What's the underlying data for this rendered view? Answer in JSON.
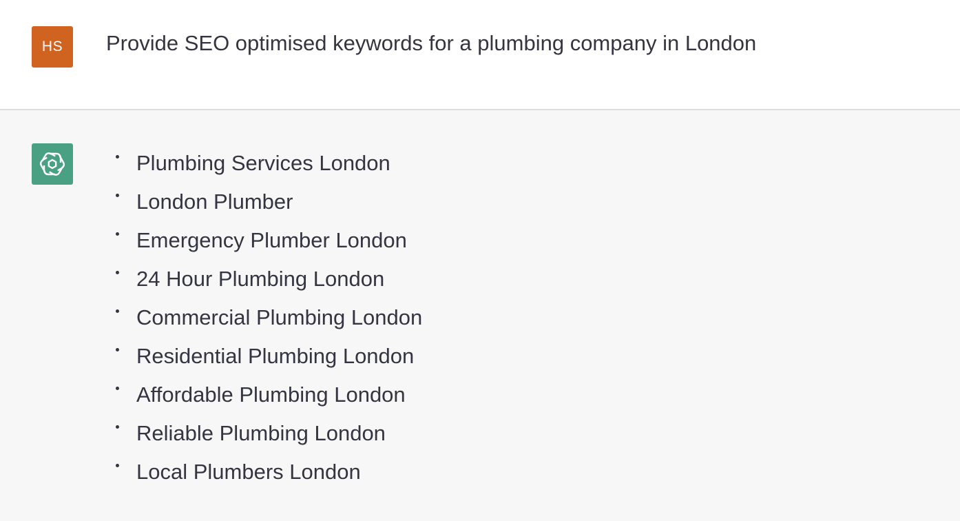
{
  "conversation": {
    "user": {
      "avatar_initials": "HS",
      "avatar_color": "#d0631f",
      "message": "Provide SEO optimised keywords for a plumbing company in London"
    },
    "assistant": {
      "avatar_icon": "openai-logo-icon",
      "avatar_color": "#4aa082",
      "keywords": [
        "Plumbing Services London",
        "London Plumber",
        "Emergency Plumber London",
        "24 Hour Plumbing London",
        "Commercial Plumbing London",
        "Residential Plumbing London",
        "Affordable Plumbing London",
        "Reliable Plumbing London",
        "Local Plumbers London"
      ]
    }
  }
}
